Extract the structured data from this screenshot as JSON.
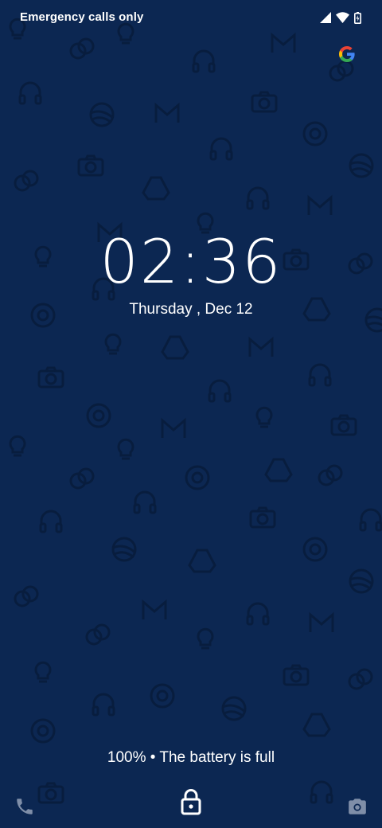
{
  "status_bar": {
    "carrier_text": "Emergency calls only",
    "icons": [
      "signal-icon",
      "wifi-icon",
      "battery-charging-icon"
    ]
  },
  "google_badge": {
    "icon": "google-g-icon"
  },
  "lockscreen": {
    "time": "02:36",
    "date": "Thursday , Dec 12",
    "battery_message": "100% • The battery is full"
  },
  "shortcuts": {
    "left_icon": "phone-icon",
    "center_icon": "lock-icon",
    "right_icon": "camera-icon"
  },
  "colors": {
    "background": "#0c2752",
    "pattern": "#081c3b",
    "text": "#ffffff",
    "shortcut_icon": "#7f8ea8"
  }
}
